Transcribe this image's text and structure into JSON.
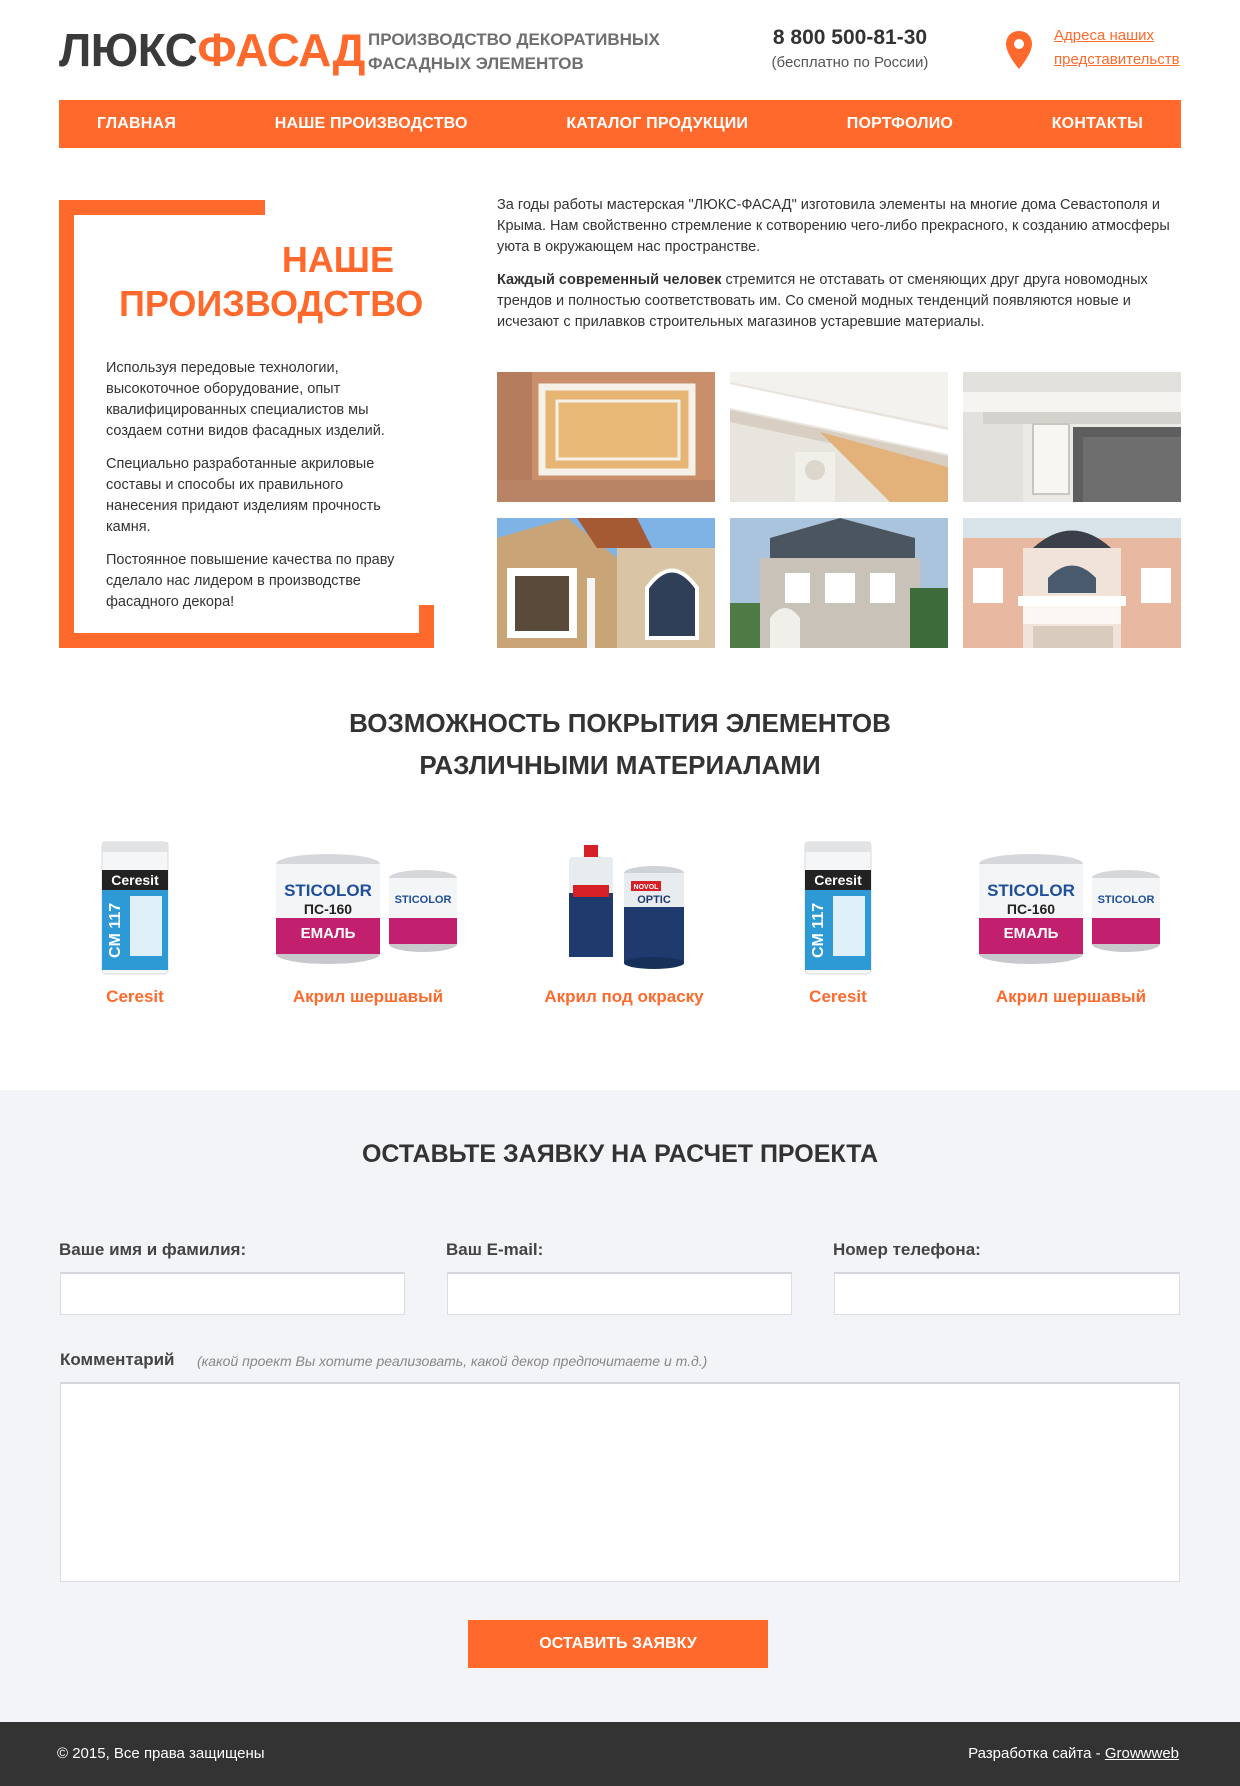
{
  "header": {
    "logo_part1": "ЛЮКС",
    "logo_part2": "ФАСАД",
    "tagline": "ПРОИЗВОДСТВО ДЕКОРАТИВНЫХ ФАСАДНЫХ ЭЛЕМЕНТОВ",
    "phone": "8 800 500-81-30",
    "phone_note": "(бесплатно по России)",
    "address_link": "Адреса наших представительств",
    "address_icon": "map-pin-icon"
  },
  "nav": {
    "items": [
      "ГЛАВНАЯ",
      "НАШЕ ПРОИЗВОДСТВО",
      "КАТАЛОГ ПРОДУКЦИИ",
      "ПОРТФОЛИО",
      "КОНТАКТЫ"
    ]
  },
  "production": {
    "title": "НАШЕ ПРОИЗВОДСТВО",
    "paragraphs": [
      "Используя передовые технологии, высокоточное оборудование, опыт квалифицированных специалистов мы создаем сотни видов фасадных изделий.",
      "Специально разработанные акриловые составы и способы их правильного нанесения придают изделиям  прочность камня.",
      "Постоянное повышение качества по праву сделало нас лидером в производстве фасадного декора!"
    ],
    "intro_p1": "За годы работы мастерская \"ЛЮКС-ФАСАД\" изготовила элементы на многие дома Севастополя и Крыма. Нам свойственно стремление к сотворению чего-либо прекрасного, к созданию атмосферы уюта в окружающем нас пространстве.",
    "intro_p2_bold": "Каждый современный человек",
    "intro_p2_rest": " стремится не отставать от сменяющих друг друга новомодных трендов и полностью соответствовать им. Со сменой модных тенденций появляются новые и исчезают с прилавков строительных магазинов устаревшие материалы."
  },
  "materials": {
    "title_line1": "ВОЗМОЖНОСТЬ ПОКРЫТИЯ ЭЛЕМЕНТОВ",
    "title_line2": "РАЗЛИЧНЫМИ МАТЕРИАЛАМИ",
    "items": [
      {
        "label": "Ceresit",
        "kind": "bag"
      },
      {
        "label": "Акрил шершавый",
        "kind": "cans"
      },
      {
        "label": "Акрил под окраску",
        "kind": "optic"
      },
      {
        "label": "Ceresit",
        "kind": "bag"
      },
      {
        "label": "Акрил шершавый",
        "kind": "cans"
      }
    ],
    "bag_brand": "Ceresit",
    "bag_code": "CM 117",
    "can_brand": "STICOLOR",
    "can_code": "ПС-160",
    "can_text": "ЕМАЛЬ",
    "optic_brand": "OPTIC",
    "optic_maker": "NOVOL"
  },
  "form": {
    "title": "ОСТАВЬТЕ ЗАЯВКУ НА РАСЧЕТ ПРОЕКТА",
    "name_label": "Ваше имя и фамилия:",
    "email_label": "Ваш E-mail:",
    "phone_label": "Номер телефона:",
    "comment_label": "Комментарий",
    "comment_hint": "(какой проект Вы хотите реализовать, какой декор предпочитаете и т.д.)",
    "submit": "ОСТАВИТЬ ЗАЯВКУ"
  },
  "footer": {
    "copyright": "© 2015, Все права защищены",
    "dev_prefix": "Разработка сайта - ",
    "dev_link": "Growwweb"
  },
  "colors": {
    "accent": "#ff6a2c",
    "dark": "#333333",
    "form_bg": "#f3f4f8"
  }
}
